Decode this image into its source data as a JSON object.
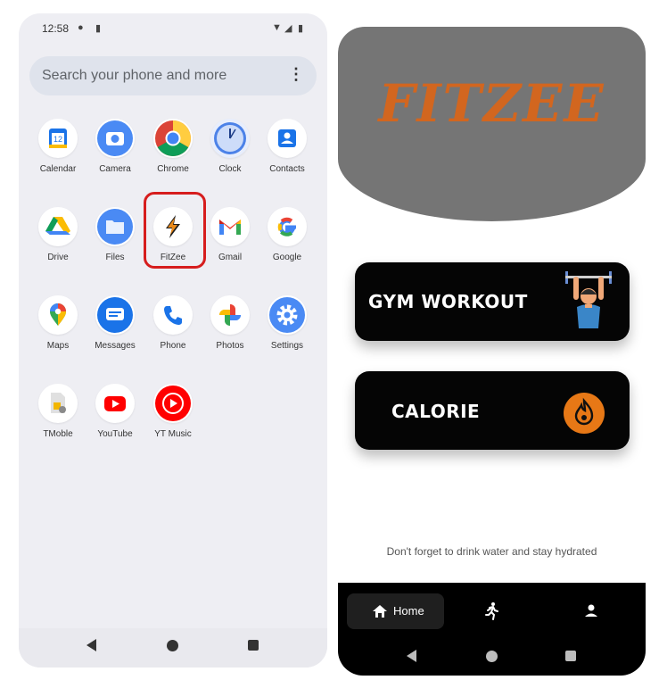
{
  "left_phone": {
    "status_bar": {
      "time": "12:58"
    },
    "search": {
      "placeholder": "Search your phone and more"
    },
    "apps": [
      {
        "label": "Calendar",
        "icon": "calendar-icon"
      },
      {
        "label": "Camera",
        "icon": "camera-icon"
      },
      {
        "label": "Chrome",
        "icon": "chrome-icon"
      },
      {
        "label": "Clock",
        "icon": "clock-icon"
      },
      {
        "label": "Contacts",
        "icon": "contacts-icon"
      },
      {
        "label": "Drive",
        "icon": "drive-icon"
      },
      {
        "label": "Files",
        "icon": "files-icon"
      },
      {
        "label": "FitZee",
        "icon": "fitzee-icon"
      },
      {
        "label": "Gmail",
        "icon": "gmail-icon"
      },
      {
        "label": "Google",
        "icon": "google-icon"
      },
      {
        "label": "Maps",
        "icon": "maps-icon"
      },
      {
        "label": "Messages",
        "icon": "messages-icon"
      },
      {
        "label": "Phone",
        "icon": "phone-icon"
      },
      {
        "label": "Photos",
        "icon": "photos-icon"
      },
      {
        "label": "Settings",
        "icon": "settings-icon"
      },
      {
        "label": "TMoble",
        "icon": "tmobile-icon"
      },
      {
        "label": "YouTube",
        "icon": "youtube-icon"
      },
      {
        "label": "YT Music",
        "icon": "yt-music-icon"
      }
    ],
    "calendar_day": "12",
    "highlight_color": "#d61d1d"
  },
  "right_phone": {
    "logo": "FITZEE",
    "cards": {
      "gym": {
        "title": "GYM WORKOUT"
      },
      "calorie": {
        "title": "CALORIE"
      }
    },
    "hint": "Don't forget to drink water and stay hydrated",
    "bottom_nav": {
      "home_label": "Home"
    },
    "colors": {
      "header": "#757575",
      "accent": "#d2661f",
      "card": "#050505"
    }
  }
}
